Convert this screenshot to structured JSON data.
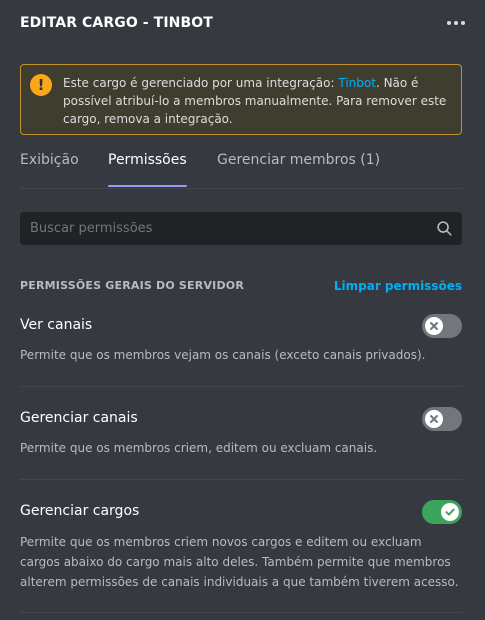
{
  "header": {
    "title": "EDITAR CARGO - TINBOT",
    "more_icon": "more-horizontal-icon"
  },
  "notice": {
    "icon": "warning-icon",
    "icon_glyph": "!",
    "text_before": "Este cargo é gerenciado por uma integração: ",
    "link": "Tinbot",
    "text_after": ". Não é possível atribuí-lo a membros manualmente. Para remover este cargo, remova a integração."
  },
  "tabs": [
    {
      "label": "Exibição",
      "active": false
    },
    {
      "label": "Permissões",
      "active": true
    },
    {
      "label": "Gerenciar membros (1)",
      "active": false
    }
  ],
  "search": {
    "placeholder": "Buscar permissões",
    "value": ""
  },
  "section": {
    "title": "PERMISSÕES GERAIS DO SERVIDOR",
    "clear_label": "Limpar permissões"
  },
  "permissions": [
    {
      "name": "Ver canais",
      "description": "Permite que os membros vejam os canais (exceto canais privados).",
      "enabled": false
    },
    {
      "name": "Gerenciar canais",
      "description": "Permite que os membros criem, editem ou excluam canais.",
      "enabled": false
    },
    {
      "name": "Gerenciar cargos",
      "description": "Permite que os membros criem novos cargos e editem ou excluam cargos abaixo do cargo mais alto deles. Também permite que membros alterem permissões de canais individuais a que também tiverem acesso.",
      "enabled": true
    }
  ],
  "colors": {
    "background": "#36393f",
    "accent_link": "#00aff4",
    "warning": "#faa81a",
    "toggle_on": "#3ba55c",
    "toggle_off": "#72767d",
    "tab_indicator": "#949cf7"
  }
}
